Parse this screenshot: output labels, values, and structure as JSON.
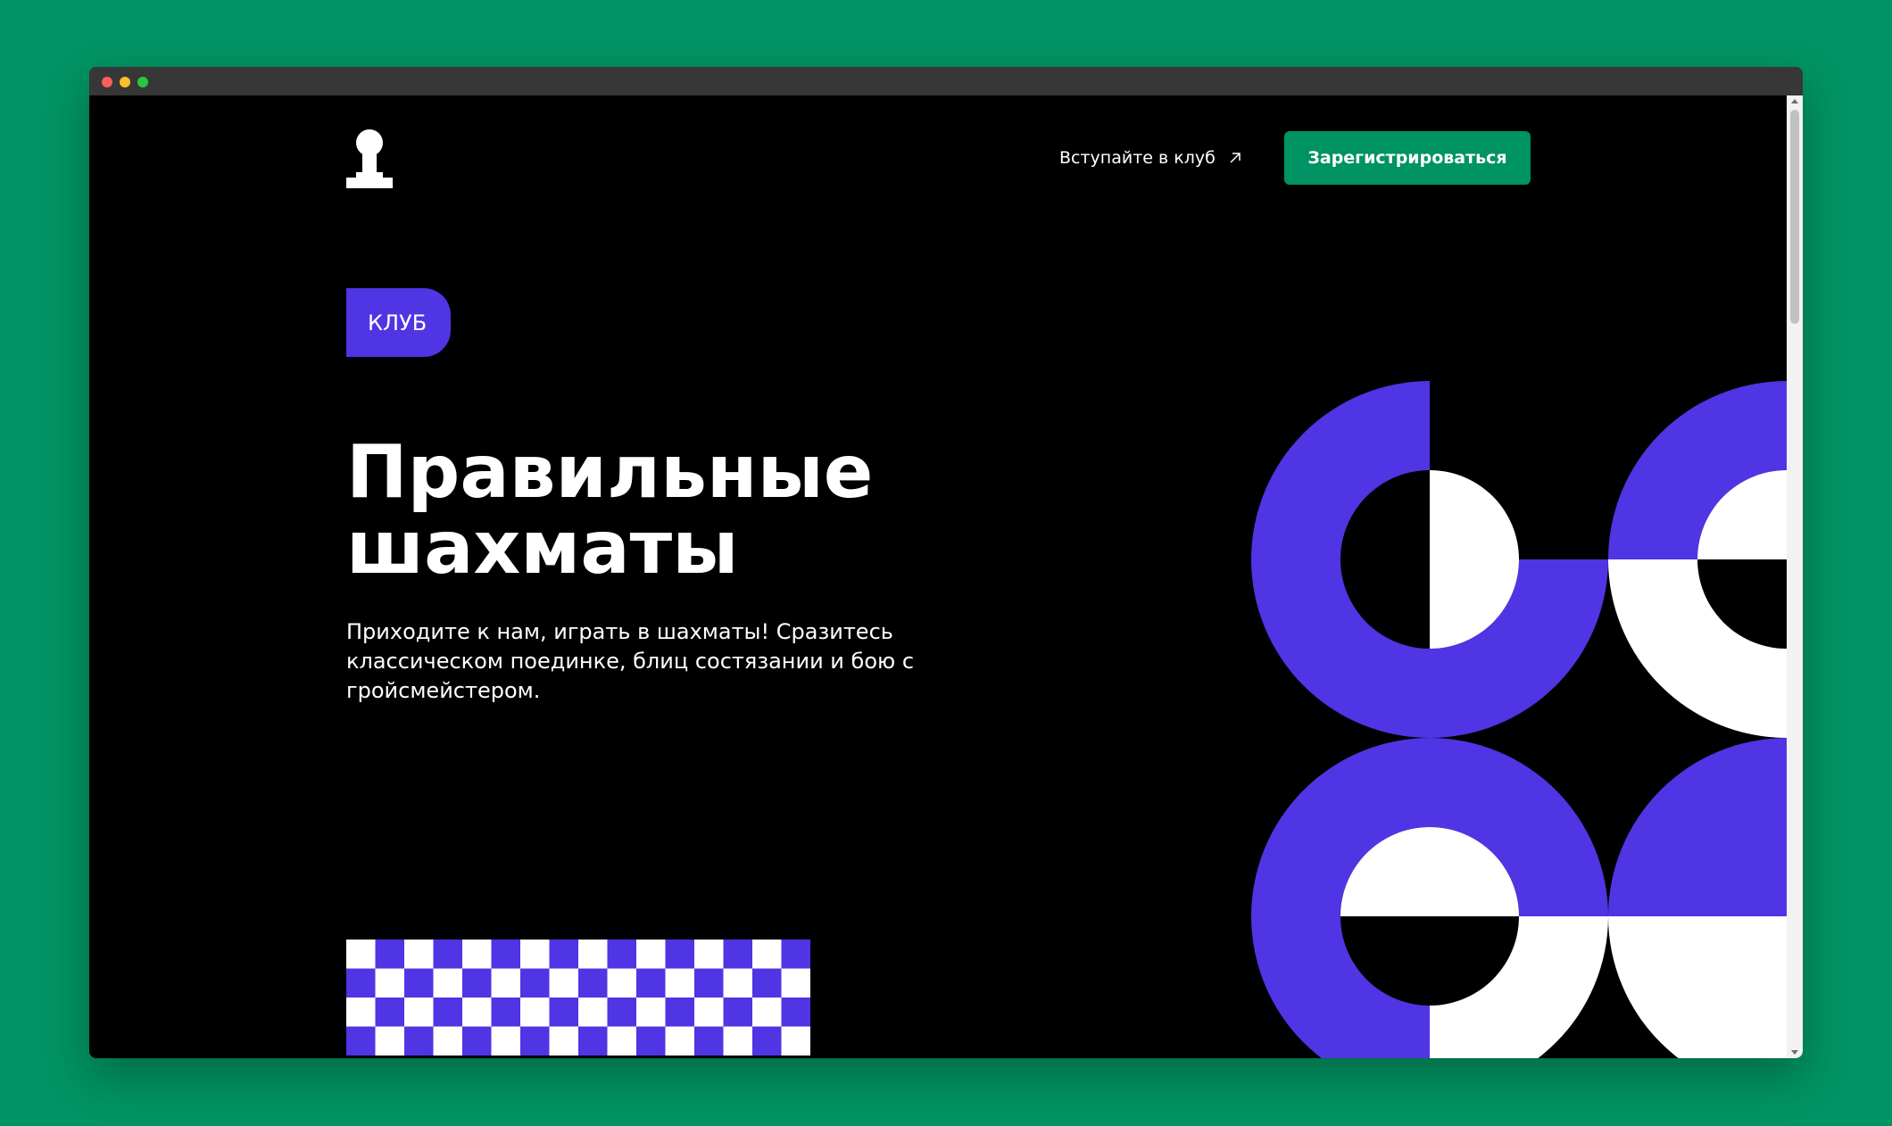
{
  "nav": {
    "link_label": "Вступайте в клуб",
    "register_label": "Зарегистрироваться"
  },
  "hero": {
    "badge": "КЛУБ",
    "title_line1": "Правильные",
    "title_line2": "шахматы",
    "description": "Приходите к нам, играть в шахматы! Сразитесь классическом поединке, блиц состязании и бою с гройсмейстером."
  },
  "icons": {
    "logo": "chess-pawn-icon",
    "link_arrow": "arrow-up-right-icon"
  },
  "colors": {
    "page_background": "#009363",
    "window_background": "#000000",
    "accent_green": "#009363",
    "accent_purple": "#4f35e3",
    "text": "#ffffff"
  }
}
